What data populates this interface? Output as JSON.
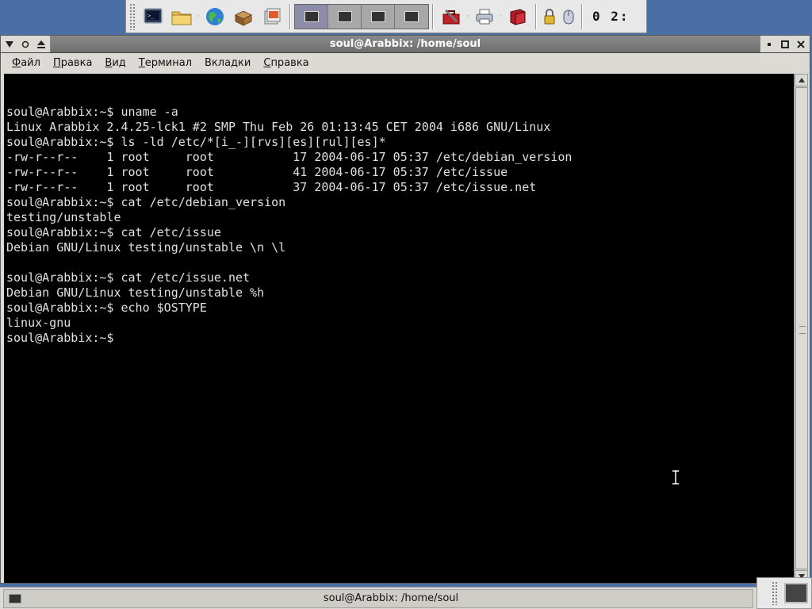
{
  "top_panel": {
    "launchers": [
      {
        "icon": "terminal-icon"
      },
      {
        "icon": "folder-icon"
      },
      {
        "icon": "globe-icon"
      },
      {
        "icon": "package-icon"
      },
      {
        "icon": "media-icon"
      }
    ],
    "workspaces": [
      {
        "active": true
      },
      {
        "active": false
      },
      {
        "active": false
      },
      {
        "active": false
      }
    ],
    "right_icons": [
      {
        "icon": "toolbox-icon"
      },
      {
        "icon": "printer-icon"
      },
      {
        "icon": "book-icon"
      },
      {
        "icon": "lock-icon"
      },
      {
        "icon": "mouse-icon"
      }
    ],
    "clock": "0 2:"
  },
  "window": {
    "title": "soul@Arabbix: /home/soul",
    "menus": [
      {
        "underlined": "Ф",
        "rest": "айл"
      },
      {
        "underlined": "П",
        "rest": "равка"
      },
      {
        "underlined": "В",
        "rest": "ид"
      },
      {
        "underlined": "Т",
        "rest": "ерминал"
      },
      {
        "underlined": "",
        "rest": "Вкладки"
      },
      {
        "underlined": "С",
        "rest": "правка"
      }
    ]
  },
  "terminal": {
    "lines": [
      "soul@Arabbix:~$ uname -a",
      "Linux Arabbix 2.4.25-lck1 #2 SMP Thu Feb 26 01:13:45 CET 2004 i686 GNU/Linux",
      "soul@Arabbix:~$ ls -ld /etc/*[i_-][rvs][es][rul][es]*",
      "-rw-r--r--    1 root     root           17 2004-06-17 05:37 /etc/debian_version",
      "-rw-r--r--    1 root     root           41 2004-06-17 05:37 /etc/issue",
      "-rw-r--r--    1 root     root           37 2004-06-17 05:37 /etc/issue.net",
      "soul@Arabbix:~$ cat /etc/debian_version",
      "testing/unstable",
      "soul@Arabbix:~$ cat /etc/issue",
      "Debian GNU/Linux testing/unstable \\n \\l",
      "",
      "soul@Arabbix:~$ cat /etc/issue.net",
      "Debian GNU/Linux testing/unstable %h",
      "soul@Arabbix:~$ echo $OSTYPE",
      "linux-gnu"
    ],
    "prompt": "soul@Arabbix:~$ "
  },
  "taskbar": {
    "task_label": "soul@Arabbix: /home/soul"
  }
}
